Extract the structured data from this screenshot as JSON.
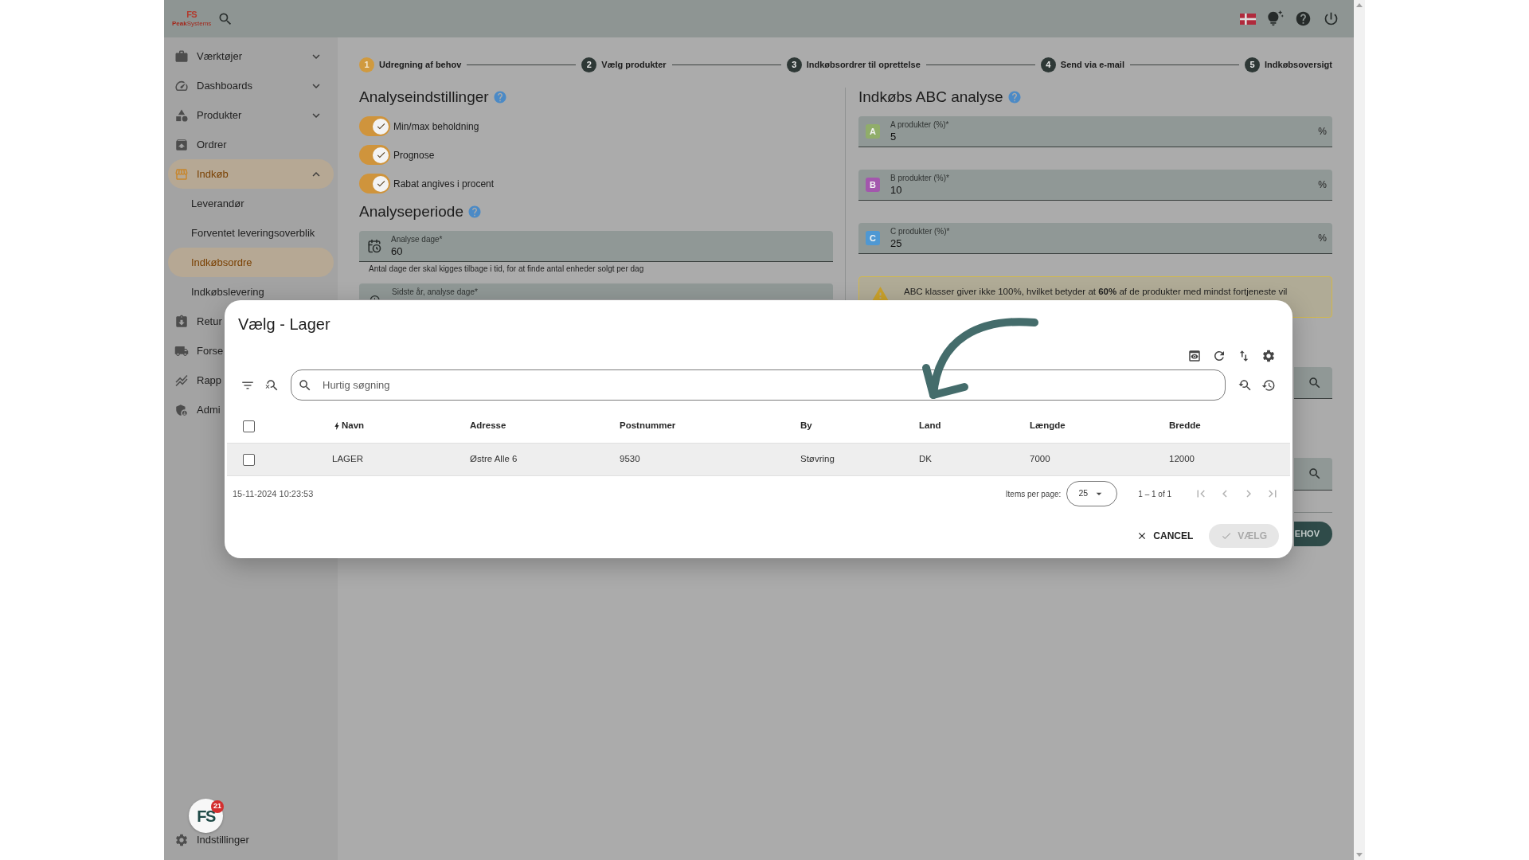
{
  "top_bar": {
    "logo": {
      "mark": "FS",
      "name": "**Peak**Systems"
    }
  },
  "sidebar": {
    "items": [
      {
        "label": "Værktøjer",
        "kind": "group",
        "expanded": false,
        "selected": false
      },
      {
        "label": "Dashboards",
        "kind": "group",
        "expanded": false,
        "selected": false
      },
      {
        "label": "Produkter",
        "kind": "group",
        "expanded": false,
        "selected": false
      },
      {
        "label": "Ordrer",
        "kind": "link",
        "selected": false
      },
      {
        "label": "Indkøb",
        "kind": "group",
        "expanded": true,
        "selected": true,
        "children": [
          {
            "label": "Leverandør",
            "selected": false
          },
          {
            "label": "Forventet leveringsoverblik",
            "selected": false
          },
          {
            "label": "Indkøbsordre",
            "selected": true
          },
          {
            "label": "Indkøbslevering",
            "selected": false
          }
        ]
      },
      {
        "label": "Retur",
        "kind": "link",
        "selected": false
      },
      {
        "label": "Forse",
        "kind": "link",
        "selected": false
      },
      {
        "label": "Rapp",
        "kind": "link",
        "selected": false
      },
      {
        "label": "Admi",
        "kind": "link",
        "selected": false
      }
    ],
    "avatar": {
      "mark": "FS",
      "badge": "21"
    },
    "settings": {
      "label": "Indstillinger"
    }
  },
  "stepper": {
    "steps": [
      {
        "number": "1",
        "label": "Udregning af behov",
        "selected": true
      },
      {
        "number": "2",
        "label": "Vælg produkter",
        "selected": false
      },
      {
        "number": "3",
        "label": "Indkøbsordrer til oprettelse",
        "selected": false
      },
      {
        "number": "4",
        "label": "Send via e-mail",
        "selected": false
      },
      {
        "number": "5",
        "label": "Indkøbsoversigt",
        "selected": false
      }
    ]
  },
  "analysis_settings": {
    "title": "Analyseindstillinger",
    "toggles": [
      {
        "label": "Min/max beholdning",
        "on": true
      },
      {
        "label": "Prognose",
        "on": true
      },
      {
        "label": "Rabat angives i procent",
        "on": true
      }
    ]
  },
  "analysis_period": {
    "title": "Analyseperiode",
    "fields": [
      {
        "label": "Analyse dage*",
        "value": "60",
        "hint": "Antal dage der skal kigges tilbage i tid, for at finde antal enheder solgt per dag"
      },
      {
        "label": "Sidste år, analyse dage*"
      }
    ]
  },
  "abc_analysis": {
    "title": "Indkøbs ABC analyse",
    "fields": [
      {
        "badge": "A",
        "color": "#90ad6a",
        "label": "A produkter (%)*",
        "value": "5",
        "suffix": "%"
      },
      {
        "badge": "B",
        "color": "#a357ad",
        "label": "B produkter (%)*",
        "value": "10",
        "suffix": "%"
      },
      {
        "badge": "C",
        "color": "#4f98d3",
        "label": "C produkter (%)*",
        "value": "25",
        "suffix": "%"
      }
    ],
    "warning": "ABC klasser giver ikke 100%, hvilket betyder at **60%** af de produkter med mindst fortjeneste vil",
    "button": "EHOV"
  },
  "modal": {
    "title": "Vælg - Lager",
    "search": {
      "placeholder": "Hurtig søgning"
    },
    "table": {
      "all_selected": false,
      "columns": [
        {
          "label": "Navn",
          "quick_search": true
        },
        {
          "label": "Adresse",
          "quick_search": false
        },
        {
          "label": "Postnummer",
          "quick_search": false
        },
        {
          "label": "By",
          "quick_search": false
        },
        {
          "label": "Land",
          "quick_search": false
        },
        {
          "label": "Længde",
          "quick_search": false
        },
        {
          "label": "Bredde",
          "quick_search": false
        }
      ],
      "rows": [
        {
          "selected": false,
          "highlighted": true,
          "cells": [
            "LAGER",
            "Østre Alle 6",
            "9530",
            "Støvring",
            "DK",
            "7000",
            "12000"
          ]
        }
      ]
    },
    "footer": {
      "timestamp": "15-11-2024 10:23:53",
      "items_per_page_label": "Items per page:",
      "items_per_page": "25",
      "range": "1 – 1 of 1",
      "pager": [
        {
          "kind": "first",
          "disabled": true
        },
        {
          "kind": "previous",
          "disabled": true
        },
        {
          "kind": "next",
          "disabled": true
        },
        {
          "kind": "last",
          "disabled": true
        }
      ]
    },
    "buttons": [
      {
        "label": "CANCEL",
        "kind": "cancel",
        "disabled": false
      },
      {
        "label": "VÆLG",
        "kind": "confirm",
        "disabled": true
      }
    ]
  }
}
